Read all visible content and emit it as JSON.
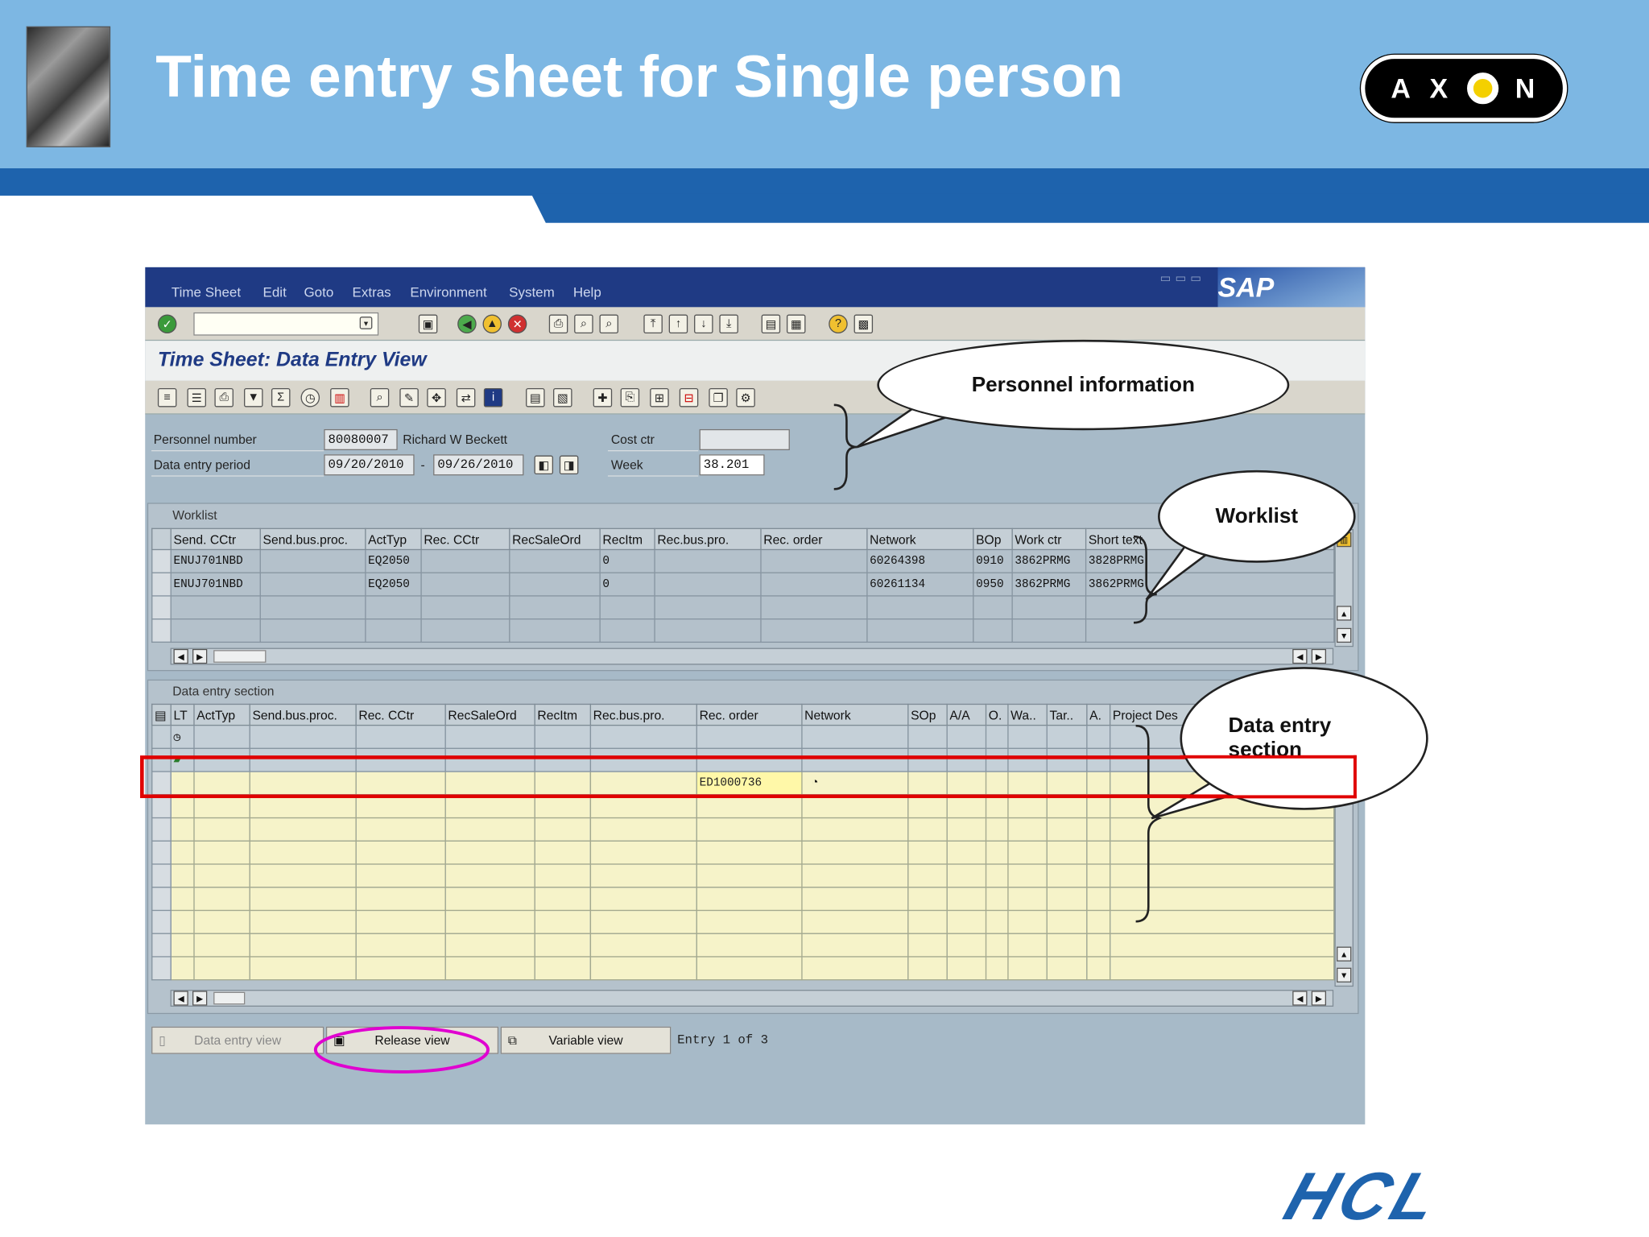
{
  "slide": {
    "title": "Time entry sheet for Single person",
    "axon_logo": "AXON",
    "axon_letters": [
      "A",
      "X",
      "N"
    ],
    "hcl_logo": "HCL"
  },
  "sap": {
    "menu": [
      "Time Sheet",
      "Edit",
      "Goto",
      "Extras",
      "Environment",
      "System",
      "Help"
    ],
    "brand": "SAP",
    "screen_title": "Time Sheet: Data Entry View",
    "header": {
      "personnel_number_label": "Personnel number",
      "personnel_number": "80080007",
      "person_name": "Richard W Beckett",
      "data_entry_period_label": "Data entry period",
      "period_from": "09/20/2010",
      "period_sep": "-",
      "period_to": "09/26/2010",
      "cost_ctr_label": "Cost ctr",
      "cost_ctr": "",
      "week_label": "Week",
      "week": "38.201"
    },
    "worklist": {
      "title": "Worklist",
      "columns": [
        "Send. CCtr",
        "Send.bus.proc.",
        "ActTyp",
        "Rec. CCtr",
        "RecSaleOrd",
        "RecItm",
        "Rec.bus.pro.",
        "Rec. order",
        "Network",
        "BOp",
        "Work ctr",
        "Short text"
      ],
      "rows": [
        [
          "ENUJ701NBD",
          "",
          "EQ2050",
          "",
          "",
          "0",
          "",
          "",
          "60264398",
          "0910",
          "3862PRMG",
          "3828PRMG"
        ],
        [
          "ENUJ701NBD",
          "",
          "EQ2050",
          "",
          "",
          "0",
          "",
          "",
          "60261134",
          "0950",
          "3862PRMG",
          "3862PRMG"
        ],
        [
          "",
          "",
          "",
          "",
          "",
          "",
          "",
          "",
          "",
          "",
          "",
          ""
        ],
        [
          "",
          "",
          "",
          "",
          "",
          "",
          "",
          "",
          "",
          "",
          "",
          ""
        ]
      ]
    },
    "data_entry": {
      "title": "Data entry section",
      "columns": [
        "LT",
        "ActTyp",
        "Send.bus.proc.",
        "Rec. CCtr",
        "RecSaleOrd",
        "RecItm",
        "Rec.bus.pro.",
        "Rec. order",
        "Network",
        "SOp",
        "A/A",
        "O.",
        "Wa..",
        "Tar..",
        "A.",
        "Project Des"
      ],
      "rec_order_value": "ED1000736"
    },
    "buttons": {
      "data_entry_view": "Data entry view",
      "release_view": "Release view",
      "variable_view": "Variable view"
    },
    "entry_info": "Entry 1 of 3"
  },
  "callouts": {
    "personnel": "Personnel information",
    "worklist": "Worklist",
    "data_entry_line1": "Data entry",
    "data_entry_line2": "section"
  },
  "colors": {
    "banner": "#7db7e3",
    "stripe": "#1e63ad",
    "sap_menu": "#1f3a84",
    "sap_body": "#a7bac8",
    "highlight_red": "#e00000",
    "highlight_magenta": "#e000d0",
    "entry_yellow": "#f6f3c9"
  }
}
